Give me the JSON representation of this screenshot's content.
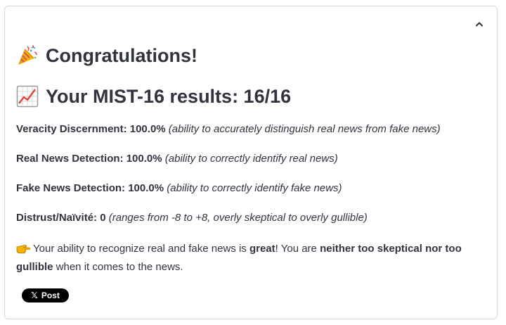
{
  "header": {
    "congrats_title": "Congratulations!",
    "results_title": "Your MIST-16 results: 16/16",
    "collapse_icon": "chevron-up-icon"
  },
  "stats": [
    {
      "label": "Veracity Discernment:",
      "value": "100.0%",
      "description": "(ability to accurately distinguish real news from fake news)"
    },
    {
      "label": "Real News Detection:",
      "value": "100.0%",
      "description": "(ability to correctly identify real news)"
    },
    {
      "label": "Fake News Detection:",
      "value": "100.0%",
      "description": "(ability to correctly identify fake news)"
    },
    {
      "label": "Distrust/Naïvité:",
      "value": "0",
      "description": "(ranges from -8 to +8, overly skeptical to overly gullible)"
    }
  ],
  "summary": {
    "part1": "Your ability to recognize real and fake news is ",
    "bold1": "great",
    "part2": "! You are ",
    "bold2": "neither too skeptical nor too gullible",
    "part3": " when it comes to the news."
  },
  "tweet": {
    "logo": "𝕏",
    "label": "Post"
  },
  "icons": [
    "party-popper-icon",
    "chart-increasing-icon",
    "pointing-hand-icon",
    "x-logo-icon"
  ]
}
